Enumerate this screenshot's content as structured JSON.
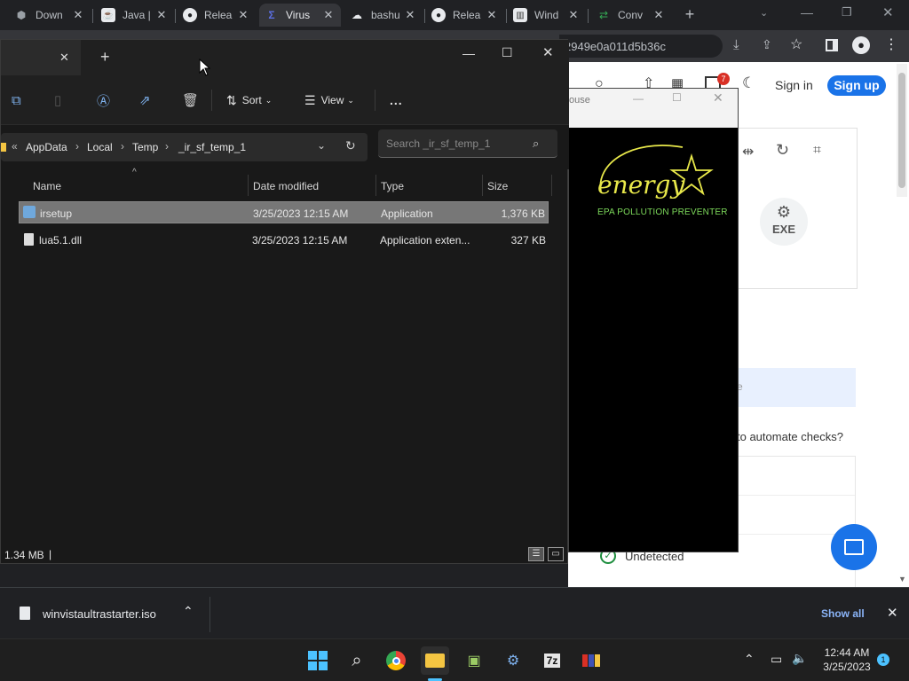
{
  "browser": {
    "tabs": [
      {
        "title": "Down",
        "icon": "cube-icon"
      },
      {
        "title": "Java |",
        "icon": "java-icon"
      },
      {
        "title": "Relea",
        "icon": "github-icon"
      },
      {
        "title": "Virus",
        "icon": "virustotal-icon"
      },
      {
        "title": "bashu",
        "icon": "cloud-icon"
      },
      {
        "title": "Relea",
        "icon": "github-icon"
      },
      {
        "title": "Wind",
        "icon": "archive-icon"
      },
      {
        "title": "Conv",
        "icon": "convert-icon"
      }
    ],
    "url_fragment": "2949e0a011d5b36c",
    "notification_count": "7",
    "sign_in": "Sign in",
    "sign_up": "Sign up"
  },
  "page": {
    "exe_label": "EXE",
    "truncated_e": "e",
    "automate_text": "to automate checks?",
    "status": "Undetected"
  },
  "explorer": {
    "toolbar": {
      "sort": "Sort",
      "view": "View",
      "more": "..."
    },
    "breadcrumb": [
      "AppData",
      "Local",
      "Temp",
      "_ir_sf_temp_1"
    ],
    "search_placeholder": "Search _ir_sf_temp_1",
    "columns": {
      "name": "Name",
      "date": "Date modified",
      "type": "Type",
      "size": "Size"
    },
    "files": [
      {
        "name": "irsetup",
        "date": "3/25/2023 12:15 AM",
        "type": "Application",
        "size": "1,376 KB"
      },
      {
        "name": "lua5.1.dll",
        "date": "3/25/2023 12:15 AM",
        "type": "Application exten...",
        "size": "327 KB"
      }
    ],
    "status": "1.34 MB"
  },
  "energy_window": {
    "title": "ouse",
    "logo_text": "energy",
    "caption": "EPA POLLUTION PREVENTER"
  },
  "downloads": {
    "file": "winvistaultrastarter.iso",
    "show_all": "Show all"
  },
  "taskbar": {
    "time": "12:44 AM",
    "date": "3/25/2023",
    "notif": "1",
    "sevenzip": "7z"
  },
  "colors": {
    "accent": "#1a73e8",
    "selected_row": "#777777",
    "energy_yellow": "#e8e84a",
    "energy_green": "#7cd85a"
  }
}
